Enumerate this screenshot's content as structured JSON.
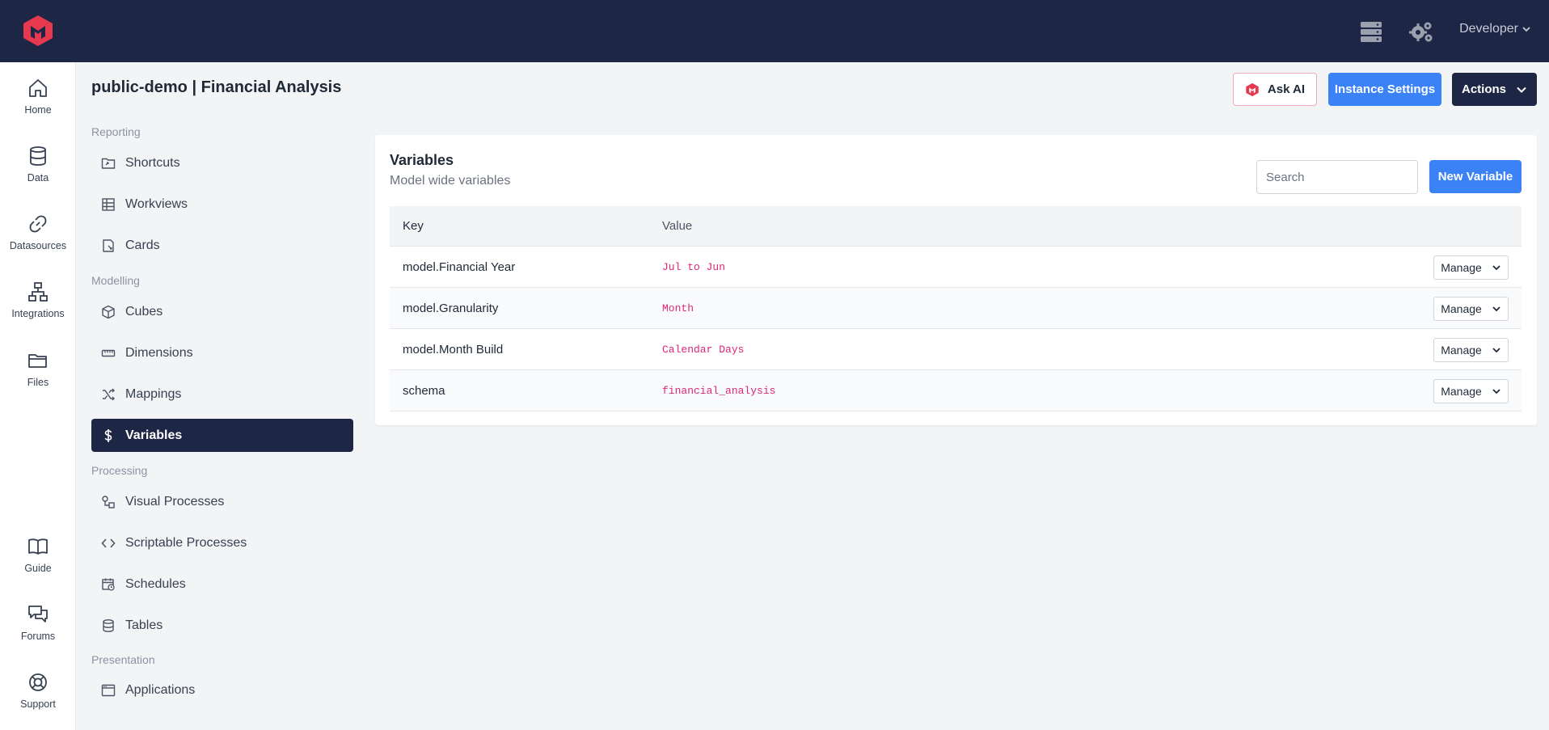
{
  "topbar": {
    "user": "Developer",
    "icons": [
      "logo-icon",
      "server-icon",
      "gears-icon",
      "chevron-down-icon"
    ]
  },
  "rail": {
    "home": "Home",
    "data": "Data",
    "datasources": "Datasources",
    "integrations": "Integrations",
    "files": "Files",
    "guide": "Guide",
    "forums": "Forums",
    "support": "Support"
  },
  "header": {
    "title": "public-demo | Financial Analysis",
    "ask_ai": "Ask AI",
    "instance_settings": "Instance Settings",
    "actions": "Actions"
  },
  "nav": {
    "reporting": "Reporting",
    "shortcuts": "Shortcuts",
    "workviews": "Workviews",
    "cards": "Cards",
    "modelling": "Modelling",
    "cubes": "Cubes",
    "dimensions": "Dimensions",
    "mappings": "Mappings",
    "variables": "Variables",
    "processing": "Processing",
    "visual_processes": "Visual Processes",
    "scriptable_processes": "Scriptable Processes",
    "schedules": "Schedules",
    "tables": "Tables",
    "presentation": "Presentation",
    "applications": "Applications"
  },
  "variables": {
    "title": "Variables",
    "subtitle": "Model wide variables",
    "search_placeholder": "Search",
    "new_button": "New Variable",
    "columns": {
      "key": "Key",
      "value": "Value"
    },
    "rows": [
      {
        "key": "model.Financial Year",
        "value": "Jul to Jun",
        "action": "Manage"
      },
      {
        "key": "model.Granularity",
        "value": "Month",
        "action": "Manage"
      },
      {
        "key": "model.Month Build",
        "value": "Calendar Days",
        "action": "Manage"
      },
      {
        "key": "schema",
        "value": "financial_analysis",
        "action": "Manage"
      }
    ]
  },
  "colors": {
    "topbar": "#1e2646",
    "accent_blue": "#3b82f6",
    "active_nav": "#1e2646",
    "value_pink": "#db2777",
    "logo_red": "#e63950"
  }
}
